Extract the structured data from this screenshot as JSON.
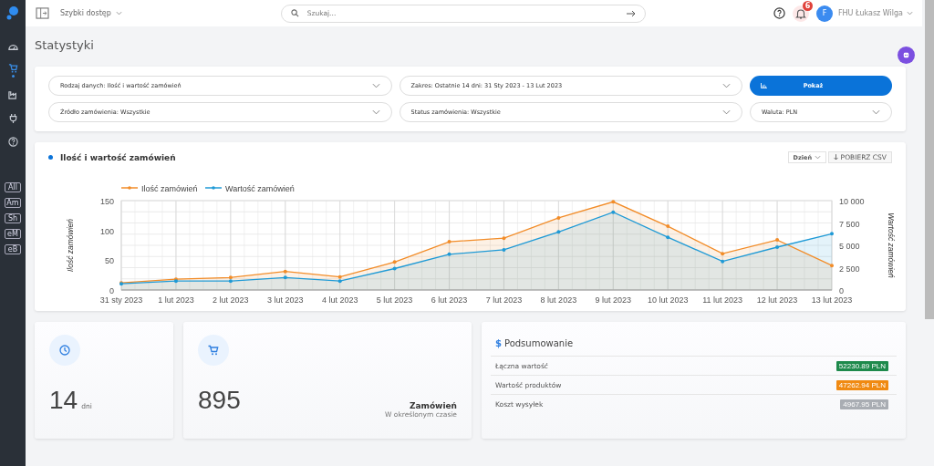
{
  "sidebar": {
    "items": [
      {
        "kind": "gauge",
        "selected": false
      },
      {
        "kind": "cart",
        "selected": true
      },
      {
        "kind": "factory",
        "selected": false
      },
      {
        "kind": "plug",
        "selected": false
      },
      {
        "kind": "help",
        "selected": false
      }
    ],
    "shortcuts": [
      "All",
      "Am",
      "Sh",
      "eM",
      "eB"
    ]
  },
  "topbar": {
    "quick_access": "Szybki dostęp",
    "search": {
      "placeholder": "Szukaj..."
    },
    "notifications": "6",
    "avatar": "F",
    "user": "FHU Łukasz Wilga"
  },
  "page_title": "Statystyki",
  "filters": [
    {
      "label": "Rodzaj danych: Ilość i wartość zamówień"
    },
    {
      "label": "Zakres: Ostatnie 14 dni: 31 Sty 2023 - 13 Lut 2023"
    },
    {
      "label": "Źródło zamówienia: Wszystkie"
    },
    {
      "label": "Status zamówienia: Wszystkie"
    },
    {
      "label": "Waluta: PLN"
    }
  ],
  "show_button": "Pokaż",
  "chart_card": {
    "title": "Ilość i wartość zamówień",
    "period": "Dzień",
    "csv_button": "POBIERZ CSV",
    "chart_data": {
      "type": "area",
      "grid": true,
      "legend": true,
      "ylabel": "Ilość zamówień",
      "y2label": "Wartość zamówień",
      "ylim": [
        0,
        150
      ],
      "yticks": [
        0,
        50,
        100,
        150
      ],
      "y2lim": [
        0,
        10000
      ],
      "y2ticks": [
        {
          "value": 0,
          "label": "0"
        },
        {
          "value": 2500,
          "label": "2 500"
        },
        {
          "value": 5000,
          "label": "5 000"
        },
        {
          "value": 7500,
          "label": "7 500"
        },
        {
          "value": 10000,
          "label": "10 000"
        }
      ],
      "categories": [
        "31 sty 2023",
        "1 lut 2023",
        "2 lut 2023",
        "3 lut 2023",
        "4 lut 2023",
        "5 lut 2023",
        "6 lut 2023",
        "7 lut 2023",
        "8 lut 2023",
        "9 lut 2023",
        "10 lut 2023",
        "11 lut 2023",
        "12 lut 2023",
        "13 lut 2023"
      ],
      "series": [
        {
          "name": "Ilość zamówień",
          "color": "#f28c28",
          "values": [
            12,
            18,
            21,
            31,
            22,
            47,
            81,
            87,
            121,
            148,
            107,
            61,
            84,
            41
          ]
        },
        {
          "name": "Wartość zamówień",
          "color": "#1f9ad6",
          "axis": "y2",
          "values": [
            700,
            1000,
            1000,
            1400,
            1000,
            2400,
            4000,
            4500,
            6500,
            8700,
            5900,
            3200,
            4800,
            6300
          ]
        }
      ]
    }
  },
  "stats": [
    {
      "kind": "clock",
      "value": "14",
      "unit": "dni"
    },
    {
      "kind": "cart",
      "value": "895",
      "label": "Zamówień",
      "sublabel": "W określonym czasie"
    }
  ],
  "summary": {
    "icon_text": "$",
    "title": "Podsumowanie",
    "rows": [
      {
        "label": "Łączna wartość",
        "value": "52230.89 PLN",
        "color": "#1e8a4c"
      },
      {
        "label": "Wartość produktów",
        "value": "47262.94 PLN",
        "color": "#f08a12"
      },
      {
        "label": "Koszt wysyłek",
        "value": "4967.95 PLN",
        "color": "#a9adb3"
      }
    ]
  }
}
